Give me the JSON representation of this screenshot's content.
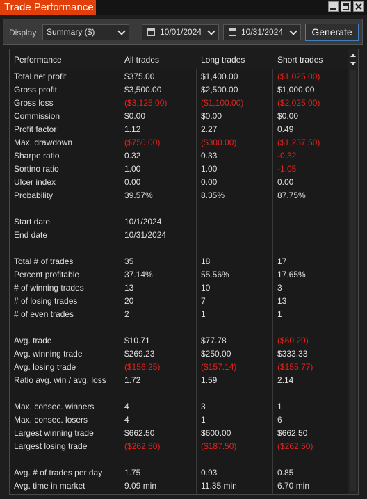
{
  "window": {
    "title": "Trade Performance"
  },
  "toolbar": {
    "display_label": "Display",
    "display_value": "Summary ($)",
    "start_date": "10/01/2024",
    "end_date": "10/31/2024",
    "generate_label": "Generate"
  },
  "columns": [
    "Performance",
    "All trades",
    "Long trades",
    "Short trades"
  ],
  "rows": [
    {
      "label": "Total net profit",
      "all": "$375.00",
      "long": "$1,400.00",
      "short": "($1,025.00)",
      "neg": [
        false,
        false,
        true
      ]
    },
    {
      "label": "Gross profit",
      "all": "$3,500.00",
      "long": "$2,500.00",
      "short": "$1,000.00",
      "neg": [
        false,
        false,
        false
      ]
    },
    {
      "label": "Gross loss",
      "all": "($3,125.00)",
      "long": "($1,100.00)",
      "short": "($2,025.00)",
      "neg": [
        true,
        true,
        true
      ]
    },
    {
      "label": "Commission",
      "all": "$0.00",
      "long": "$0.00",
      "short": "$0.00",
      "neg": [
        false,
        false,
        false
      ]
    },
    {
      "label": "Profit factor",
      "all": "1.12",
      "long": "2.27",
      "short": "0.49",
      "neg": [
        false,
        false,
        false
      ]
    },
    {
      "label": "Max. drawdown",
      "all": "($750.00)",
      "long": "($300.00)",
      "short": "($1,237.50)",
      "neg": [
        true,
        true,
        true
      ]
    },
    {
      "label": "Sharpe ratio",
      "all": "0.32",
      "long": "0.33",
      "short": "-0.32",
      "neg": [
        false,
        false,
        true
      ]
    },
    {
      "label": "Sortino ratio",
      "all": "1.00",
      "long": "1.00",
      "short": "-1.05",
      "neg": [
        false,
        false,
        true
      ]
    },
    {
      "label": "Ulcer index",
      "all": "0.00",
      "long": "0.00",
      "short": "0.00",
      "neg": [
        false,
        false,
        false
      ]
    },
    {
      "label": "Probability",
      "all": "39.57%",
      "long": "8.35%",
      "short": "87.75%",
      "neg": [
        false,
        false,
        false
      ]
    },
    {
      "label": "",
      "all": "",
      "long": "",
      "short": "",
      "neg": [
        false,
        false,
        false
      ]
    },
    {
      "label": "Start date",
      "all": "10/1/2024",
      "long": "",
      "short": "",
      "neg": [
        false,
        false,
        false
      ]
    },
    {
      "label": "End date",
      "all": "10/31/2024",
      "long": "",
      "short": "",
      "neg": [
        false,
        false,
        false
      ]
    },
    {
      "label": "",
      "all": "",
      "long": "",
      "short": "",
      "neg": [
        false,
        false,
        false
      ]
    },
    {
      "label": "Total # of trades",
      "all": "35",
      "long": "18",
      "short": "17",
      "neg": [
        false,
        false,
        false
      ]
    },
    {
      "label": "Percent profitable",
      "all": "37.14%",
      "long": "55.56%",
      "short": "17.65%",
      "neg": [
        false,
        false,
        false
      ]
    },
    {
      "label": "# of winning trades",
      "all": "13",
      "long": "10",
      "short": "3",
      "neg": [
        false,
        false,
        false
      ]
    },
    {
      "label": "# of losing trades",
      "all": "20",
      "long": "7",
      "short": "13",
      "neg": [
        false,
        false,
        false
      ]
    },
    {
      "label": "# of even trades",
      "all": "2",
      "long": "1",
      "short": "1",
      "neg": [
        false,
        false,
        false
      ]
    },
    {
      "label": "",
      "all": "",
      "long": "",
      "short": "",
      "neg": [
        false,
        false,
        false
      ]
    },
    {
      "label": "Avg. trade",
      "all": "$10.71",
      "long": "$77.78",
      "short": "($60.29)",
      "neg": [
        false,
        false,
        true
      ]
    },
    {
      "label": "Avg. winning trade",
      "all": "$269.23",
      "long": "$250.00",
      "short": "$333.33",
      "neg": [
        false,
        false,
        false
      ]
    },
    {
      "label": "Avg. losing trade",
      "all": "($156.25)",
      "long": "($157.14)",
      "short": "($155.77)",
      "neg": [
        true,
        true,
        true
      ]
    },
    {
      "label": "Ratio avg. win / avg. loss",
      "all": "1.72",
      "long": "1.59",
      "short": "2.14",
      "neg": [
        false,
        false,
        false
      ]
    },
    {
      "label": "",
      "all": "",
      "long": "",
      "short": "",
      "neg": [
        false,
        false,
        false
      ]
    },
    {
      "label": "Max. consec. winners",
      "all": "4",
      "long": "3",
      "short": "1",
      "neg": [
        false,
        false,
        false
      ]
    },
    {
      "label": "Max. consec. losers",
      "all": "4",
      "long": "1",
      "short": "6",
      "neg": [
        false,
        false,
        false
      ]
    },
    {
      "label": "Largest winning trade",
      "all": "$662.50",
      "long": "$600.00",
      "short": "$662.50",
      "neg": [
        false,
        false,
        false
      ]
    },
    {
      "label": "Largest losing trade",
      "all": "($262.50)",
      "long": "($187.50)",
      "short": "($262.50)",
      "neg": [
        true,
        true,
        true
      ]
    },
    {
      "label": "",
      "all": "",
      "long": "",
      "short": "",
      "neg": [
        false,
        false,
        false
      ]
    },
    {
      "label": "Avg. # of trades per day",
      "all": "1.75",
      "long": "0.93",
      "short": "0.85",
      "neg": [
        false,
        false,
        false
      ]
    },
    {
      "label": "Avg. time in market",
      "all": "9.09 min",
      "long": "11.35 min",
      "short": "6.70 min",
      "neg": [
        false,
        false,
        false
      ]
    }
  ],
  "colors": {
    "accent": "#e2400a",
    "negative": "#e3231e",
    "button_border": "#3f7fbf"
  }
}
